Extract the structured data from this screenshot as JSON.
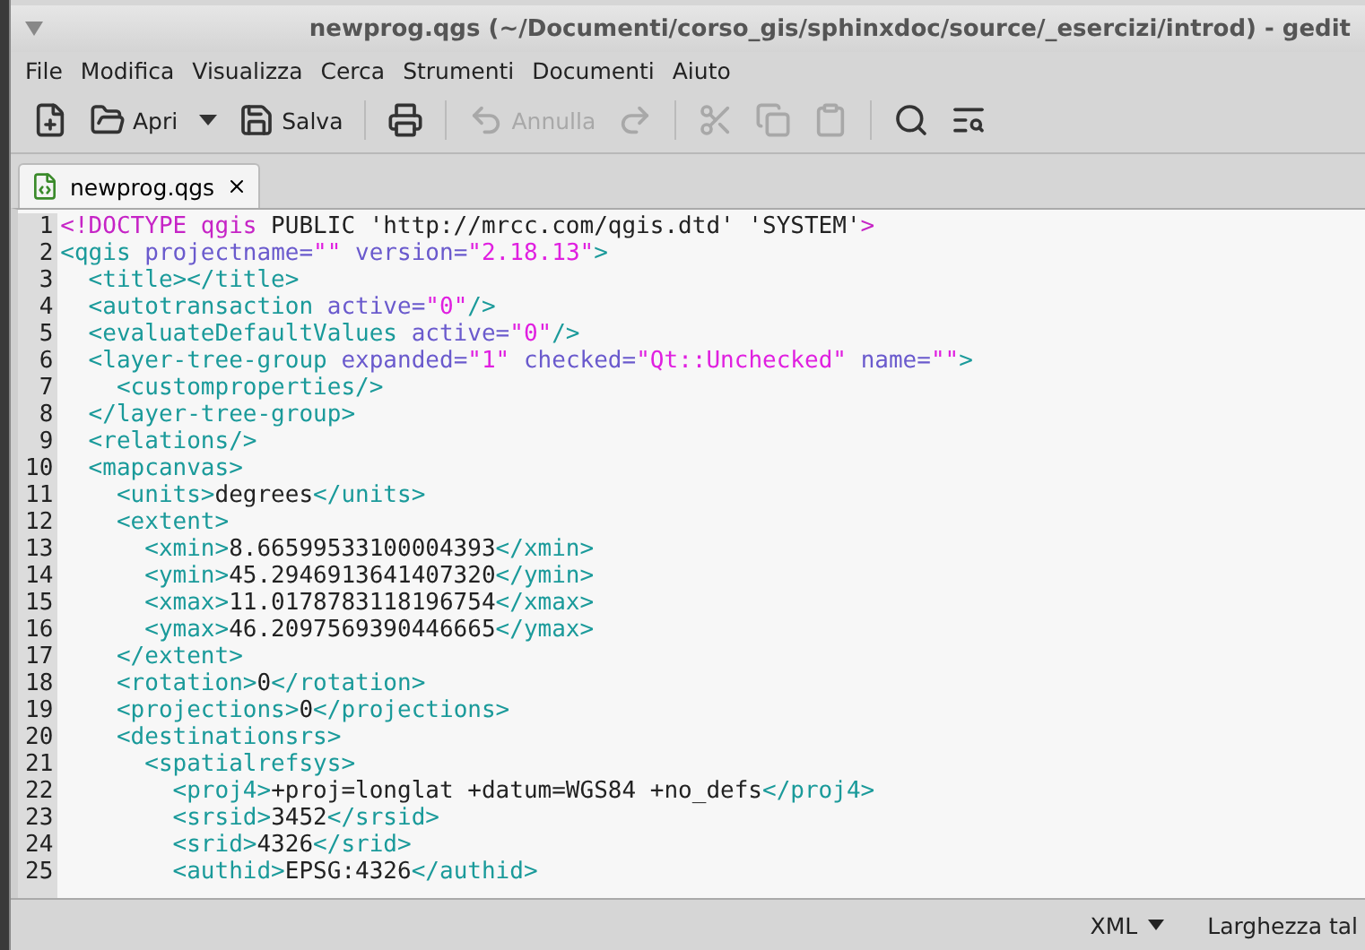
{
  "window": {
    "title": "newprog.qgs (~/Documenti/corso_gis/sphinxdoc/source/_esercizi/introd) - gedit"
  },
  "menu": [
    "File",
    "Modifica",
    "Visualizza",
    "Cerca",
    "Strumenti",
    "Documenti",
    "Aiuto"
  ],
  "toolbar": [
    {
      "kind": "new",
      "disabled": false
    },
    {
      "kind": "open",
      "label": "Apri",
      "disabled": false
    },
    {
      "kind": "dropdown",
      "disabled": false
    },
    {
      "kind": "save",
      "label": "Salva",
      "disabled": false
    },
    {
      "kind": "separator"
    },
    {
      "kind": "print",
      "disabled": false
    },
    {
      "kind": "separator"
    },
    {
      "kind": "undo",
      "label": "Annulla",
      "disabled": true
    },
    {
      "kind": "redo",
      "disabled": true
    },
    {
      "kind": "separator"
    },
    {
      "kind": "cut",
      "disabled": true
    },
    {
      "kind": "copy",
      "disabled": true
    },
    {
      "kind": "paste",
      "disabled": true
    },
    {
      "kind": "separator"
    },
    {
      "kind": "find",
      "disabled": false
    },
    {
      "kind": "replace",
      "disabled": false
    }
  ],
  "tabs": [
    {
      "label": "newprog.qgs",
      "selected": true
    }
  ],
  "editor": {
    "lines": [
      {
        "number": "1",
        "segments": [
          {
            "kind": "doctype",
            "text": "<!DOCTYPE qgis"
          },
          {
            "kind": "text",
            "text": " PUBLIC 'http://mrcc.com/qgis.dtd' 'SYSTEM'"
          },
          {
            "kind": "doctype",
            "text": ">"
          }
        ]
      },
      {
        "number": "2",
        "segments": [
          {
            "kind": "tag",
            "text": "<qgis"
          },
          {
            "kind": "attr",
            "text": " projectname="
          },
          {
            "kind": "value",
            "text": "\"\""
          },
          {
            "kind": "attr",
            "text": " version="
          },
          {
            "kind": "value",
            "text": "\"2.18.13\""
          },
          {
            "kind": "tag",
            "text": ">"
          }
        ]
      },
      {
        "number": "3",
        "segments": [
          {
            "kind": "tag",
            "text": "  <title></title>"
          }
        ]
      },
      {
        "number": "4",
        "segments": [
          {
            "kind": "tag",
            "text": "  <autotransaction"
          },
          {
            "kind": "attr",
            "text": " active="
          },
          {
            "kind": "value",
            "text": "\"0\""
          },
          {
            "kind": "tag",
            "text": "/>"
          }
        ]
      },
      {
        "number": "5",
        "segments": [
          {
            "kind": "tag",
            "text": "  <evaluateDefaultValues"
          },
          {
            "kind": "attr",
            "text": " active="
          },
          {
            "kind": "value",
            "text": "\"0\""
          },
          {
            "kind": "tag",
            "text": "/>"
          }
        ]
      },
      {
        "number": "6",
        "segments": [
          {
            "kind": "tag",
            "text": "  <layer-tree-group"
          },
          {
            "kind": "attr",
            "text": " expanded="
          },
          {
            "kind": "value",
            "text": "\"1\""
          },
          {
            "kind": "attr",
            "text": " checked="
          },
          {
            "kind": "value",
            "text": "\"Qt::Unchecked\""
          },
          {
            "kind": "attr",
            "text": " name="
          },
          {
            "kind": "value",
            "text": "\"\""
          },
          {
            "kind": "tag",
            "text": ">"
          }
        ]
      },
      {
        "number": "7",
        "segments": [
          {
            "kind": "tag",
            "text": "    <customproperties/>"
          }
        ]
      },
      {
        "number": "8",
        "segments": [
          {
            "kind": "tag",
            "text": "  </layer-tree-group>"
          }
        ]
      },
      {
        "number": "9",
        "segments": [
          {
            "kind": "tag",
            "text": "  <relations/>"
          }
        ]
      },
      {
        "number": "10",
        "segments": [
          {
            "kind": "tag",
            "text": "  <mapcanvas>"
          }
        ]
      },
      {
        "number": "11",
        "segments": [
          {
            "kind": "tag",
            "text": "    <units>"
          },
          {
            "kind": "text",
            "text": "degrees"
          },
          {
            "kind": "tag",
            "text": "</units>"
          }
        ]
      },
      {
        "number": "12",
        "segments": [
          {
            "kind": "tag",
            "text": "    <extent>"
          }
        ]
      },
      {
        "number": "13",
        "segments": [
          {
            "kind": "tag",
            "text": "      <xmin>"
          },
          {
            "kind": "text",
            "text": "8.66599533100004393"
          },
          {
            "kind": "tag",
            "text": "</xmin>"
          }
        ]
      },
      {
        "number": "14",
        "segments": [
          {
            "kind": "tag",
            "text": "      <ymin>"
          },
          {
            "kind": "text",
            "text": "45.2946913641407320"
          },
          {
            "kind": "tag",
            "text": "</ymin>"
          }
        ]
      },
      {
        "number": "15",
        "segments": [
          {
            "kind": "tag",
            "text": "      <xmax>"
          },
          {
            "kind": "text",
            "text": "11.0178783118196754"
          },
          {
            "kind": "tag",
            "text": "</xmax>"
          }
        ]
      },
      {
        "number": "16",
        "segments": [
          {
            "kind": "tag",
            "text": "      <ymax>"
          },
          {
            "kind": "text",
            "text": "46.2097569390446665"
          },
          {
            "kind": "tag",
            "text": "</ymax>"
          }
        ]
      },
      {
        "number": "17",
        "segments": [
          {
            "kind": "tag",
            "text": "    </extent>"
          }
        ]
      },
      {
        "number": "18",
        "segments": [
          {
            "kind": "tag",
            "text": "    <rotation>"
          },
          {
            "kind": "text",
            "text": "0"
          },
          {
            "kind": "tag",
            "text": "</rotation>"
          }
        ]
      },
      {
        "number": "19",
        "segments": [
          {
            "kind": "tag",
            "text": "    <projections>"
          },
          {
            "kind": "text",
            "text": "0"
          },
          {
            "kind": "tag",
            "text": "</projections>"
          }
        ]
      },
      {
        "number": "20",
        "segments": [
          {
            "kind": "tag",
            "text": "    <destinationsrs>"
          }
        ]
      },
      {
        "number": "21",
        "segments": [
          {
            "kind": "tag",
            "text": "      <spatialrefsys>"
          }
        ]
      },
      {
        "number": "22",
        "segments": [
          {
            "kind": "tag",
            "text": "        <proj4>"
          },
          {
            "kind": "text",
            "text": "+proj=longlat +datum=WGS84 +no_defs"
          },
          {
            "kind": "tag",
            "text": "</proj4>"
          }
        ]
      },
      {
        "number": "23",
        "segments": [
          {
            "kind": "tag",
            "text": "        <srsid>"
          },
          {
            "kind": "text",
            "text": "3452"
          },
          {
            "kind": "tag",
            "text": "</srsid>"
          }
        ]
      },
      {
        "number": "24",
        "segments": [
          {
            "kind": "tag",
            "text": "        <srid>"
          },
          {
            "kind": "text",
            "text": "4326"
          },
          {
            "kind": "tag",
            "text": "</srid>"
          }
        ]
      },
      {
        "number": "25",
        "segments": [
          {
            "kind": "tag",
            "text": "        <authid>"
          },
          {
            "kind": "text",
            "text": "EPSG:4326"
          },
          {
            "kind": "tag",
            "text": "</authid>"
          }
        ]
      }
    ]
  },
  "status_bar": {
    "language": "XML",
    "tab_width": "Larghezza tal"
  }
}
